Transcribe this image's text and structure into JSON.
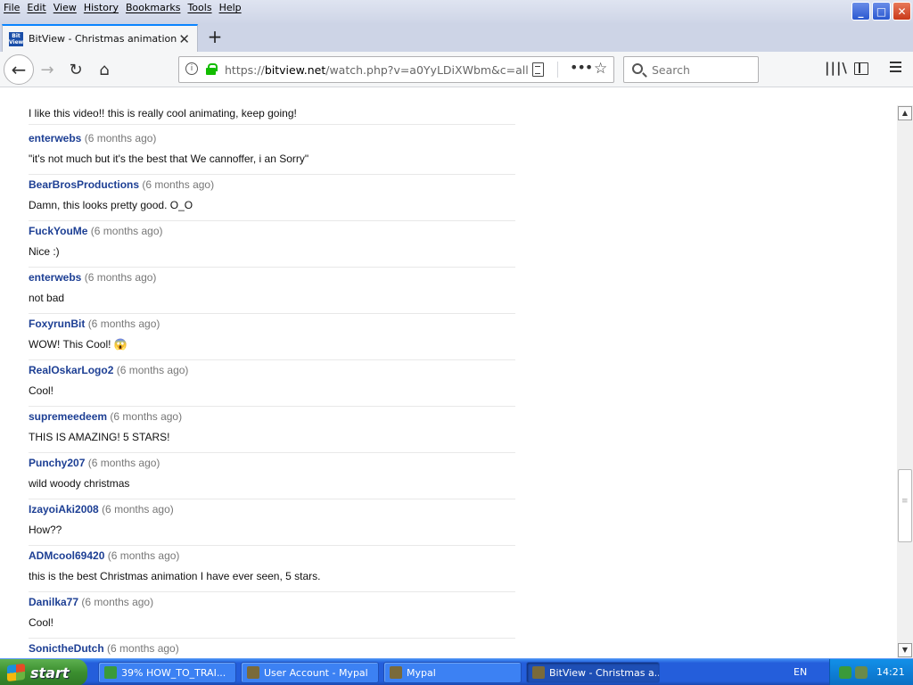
{
  "menubar": {
    "items": [
      "File",
      "Edit",
      "View",
      "History",
      "Bookmarks",
      "Tools",
      "Help"
    ]
  },
  "window_controls": {
    "minimize": "_",
    "maximize": "□",
    "close": "✕"
  },
  "tab": {
    "favicon_text": "Bit View",
    "title": "BitView - Christmas animation (cor",
    "close": "✕",
    "new_tab": "+"
  },
  "nav": {
    "back": "←",
    "forward": "→",
    "reload": "↻",
    "home": "⌂"
  },
  "urlbar": {
    "info": "i",
    "url_prefix": "https://",
    "url_domain": "bitview.net",
    "url_path": "/watch.php?v=a0YyLDiXWbm&c=all",
    "page_actions": "•••",
    "star": "☆"
  },
  "search": {
    "placeholder": "Search"
  },
  "toolbar": {
    "library": "|||\\"
  },
  "content": {
    "first_comment": "I like this video!! this is really cool animating, keep going!",
    "comments": [
      {
        "user": "enterwebs",
        "time": "(6 months ago)",
        "text": "\"it's not much but it's the best that We cannoffer, i an Sorry\""
      },
      {
        "user": "BearBrosProductions",
        "time": "(6 months ago)",
        "text": "Damn, this looks pretty good. O_O"
      },
      {
        "user": "FuckYouMe",
        "time": "(6 months ago)",
        "text": "Nice :)"
      },
      {
        "user": "enterwebs",
        "time": "(6 months ago)",
        "text": "not bad"
      },
      {
        "user": "FoxyrunBit",
        "time": "(6 months ago)",
        "text": "WOW! This Cool! 😱"
      },
      {
        "user": "RealOskarLogo2",
        "time": "(6 months ago)",
        "text": "Cool!"
      },
      {
        "user": "supremeedeem",
        "time": "(6 months ago)",
        "text": "THIS IS AMAZING! 5 STARS!"
      },
      {
        "user": "Punchy207",
        "time": "(6 months ago)",
        "text": "wild woody christmas"
      },
      {
        "user": "IzayoiAki2008",
        "time": "(6 months ago)",
        "text": "How??"
      },
      {
        "user": "ADMcool69420",
        "time": "(6 months ago)",
        "text": "this is the best Christmas animation I have ever seen, 5 stars."
      },
      {
        "user": "Danilka77",
        "time": "(6 months ago)",
        "text": "Cool!"
      },
      {
        "user": "SonictheDutch",
        "time": "(6 months ago)",
        "text": ""
      }
    ]
  },
  "scrollbar": {
    "up": "▲",
    "down": "▼"
  },
  "taskbar": {
    "start": "start",
    "tasks": [
      {
        "label": "39% HOW_TO_TRAI...",
        "icon_color": "#3a9a3a"
      },
      {
        "label": "User Account - Mypal",
        "icon_color": "#7a6a3a"
      },
      {
        "label": "Mypal",
        "icon_color": "#7a6a3a"
      },
      {
        "label": "BitView - Christmas a...",
        "icon_color": "#7a6a3a"
      }
    ],
    "language": "EN",
    "clock": "14:21"
  }
}
